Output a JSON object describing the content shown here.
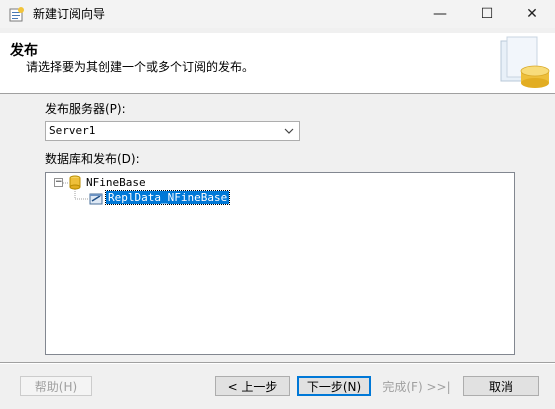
{
  "window": {
    "title": "新建订阅向导",
    "minimize_glyph": "—",
    "maximize_glyph": "☐",
    "close_glyph": "✕"
  },
  "header": {
    "title": "发布",
    "description": "请选择要为其创建一个或多个订阅的发布。"
  },
  "publisher": {
    "label": "发布服务器(P):",
    "value": "Server1"
  },
  "databases": {
    "label": "数据库和发布(D):",
    "tree": [
      {
        "label": "NFineBase",
        "expander": "−",
        "icon": "database-icon"
      },
      {
        "label": "ReplData_NFineBase",
        "icon": "publication-icon",
        "selected": true
      }
    ]
  },
  "buttons": {
    "help": "帮助(H)",
    "back": "< 上一步",
    "next": "下一步(N)",
    "finish": "完成(F) >>|",
    "cancel": "取消"
  },
  "colors": {
    "selection": "#0078d7",
    "default_button_border": "#0078d7"
  }
}
